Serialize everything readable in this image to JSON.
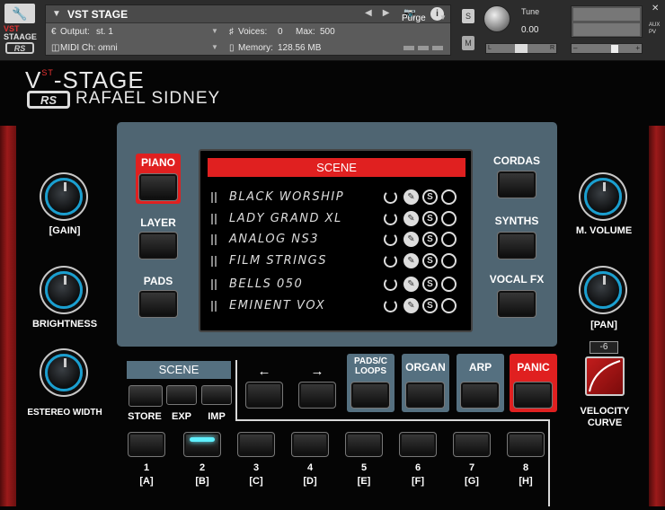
{
  "header": {
    "logo_line1": "VST",
    "logo_line2": "STAAGE",
    "logo_rs": "RS",
    "title": "VST STAGE",
    "output_label": "Output:",
    "output_value": "st. 1",
    "voices_label": "Voices:",
    "voices_value": "0",
    "max_label": "Max:",
    "max_value": "500",
    "midi_label": "MIDI Ch:",
    "midi_value": "omni",
    "memory_label": "Memory:",
    "memory_value": "128.56 MB",
    "purge_label": "Purge",
    "solo_label": "S",
    "mute_label": "M",
    "tune_label": "Tune",
    "tune_value": "0.00",
    "pan_left": "L",
    "pan_right": "R",
    "aux_label": "AUX",
    "pv_label": "PV",
    "close": "✕"
  },
  "brand": {
    "title_pre": "V",
    "title_sup": "ST",
    "title_post": "-STAGE",
    "rs": "RS",
    "subtitle": "RAFAEL SIDNEY"
  },
  "left_buttons": [
    {
      "label": "PIANO",
      "active": true
    },
    {
      "label": "LAYER",
      "active": false
    },
    {
      "label": "PADS",
      "active": false
    }
  ],
  "right_buttons": [
    {
      "label": "CORDAS"
    },
    {
      "label": "SYNTHS"
    },
    {
      "label": "VOCAL FX"
    }
  ],
  "screen": {
    "header": "SCENE",
    "slots": [
      {
        "name": "BLACK WORSHIP"
      },
      {
        "name": "LADY GRAND XL"
      },
      {
        "name": "ANALOG NS3"
      },
      {
        "name": "FILM STRINGS"
      },
      {
        "name": "BELLS 050"
      },
      {
        "name": "EMINENT VOX"
      }
    ],
    "solo_glyph": "S"
  },
  "knobs": {
    "gain": "[GAIN]",
    "brightness": "BRIGHTNESS",
    "stereo_width": "ESTEREO WIDTH",
    "master_volume": "M. VOLUME",
    "pan": "[PAN]"
  },
  "scene_section": {
    "label": "SCENE",
    "store": "STORE",
    "exp": "EXP",
    "imp": "IMP"
  },
  "nav": {
    "left_arrow": "←",
    "right_arrow": "→"
  },
  "fx_buttons": {
    "pads_loops": "PADS/C LOOPS",
    "organ": "ORGAN",
    "arp": "ARP",
    "panic": "PANIC"
  },
  "velocity": {
    "value": "-6",
    "label_line1": "VELOCITY",
    "label_line2": "CURVE"
  },
  "pads": [
    {
      "num": "1",
      "key": "[A]",
      "active": false
    },
    {
      "num": "2",
      "key": "[B]",
      "active": true
    },
    {
      "num": "3",
      "key": "[C]",
      "active": false
    },
    {
      "num": "4",
      "key": "[D]",
      "active": false
    },
    {
      "num": "5",
      "key": "[E]",
      "active": false
    },
    {
      "num": "6",
      "key": "[F]",
      "active": false
    },
    {
      "num": "7",
      "key": "[G]",
      "active": false
    },
    {
      "num": "8",
      "key": "[H]",
      "active": false
    }
  ],
  "colors": {
    "accent_red": "#e02020",
    "panel_blue": "#4f6572",
    "knob_ring": "#1a9fd0",
    "pad_led": "#5ff0ff"
  }
}
